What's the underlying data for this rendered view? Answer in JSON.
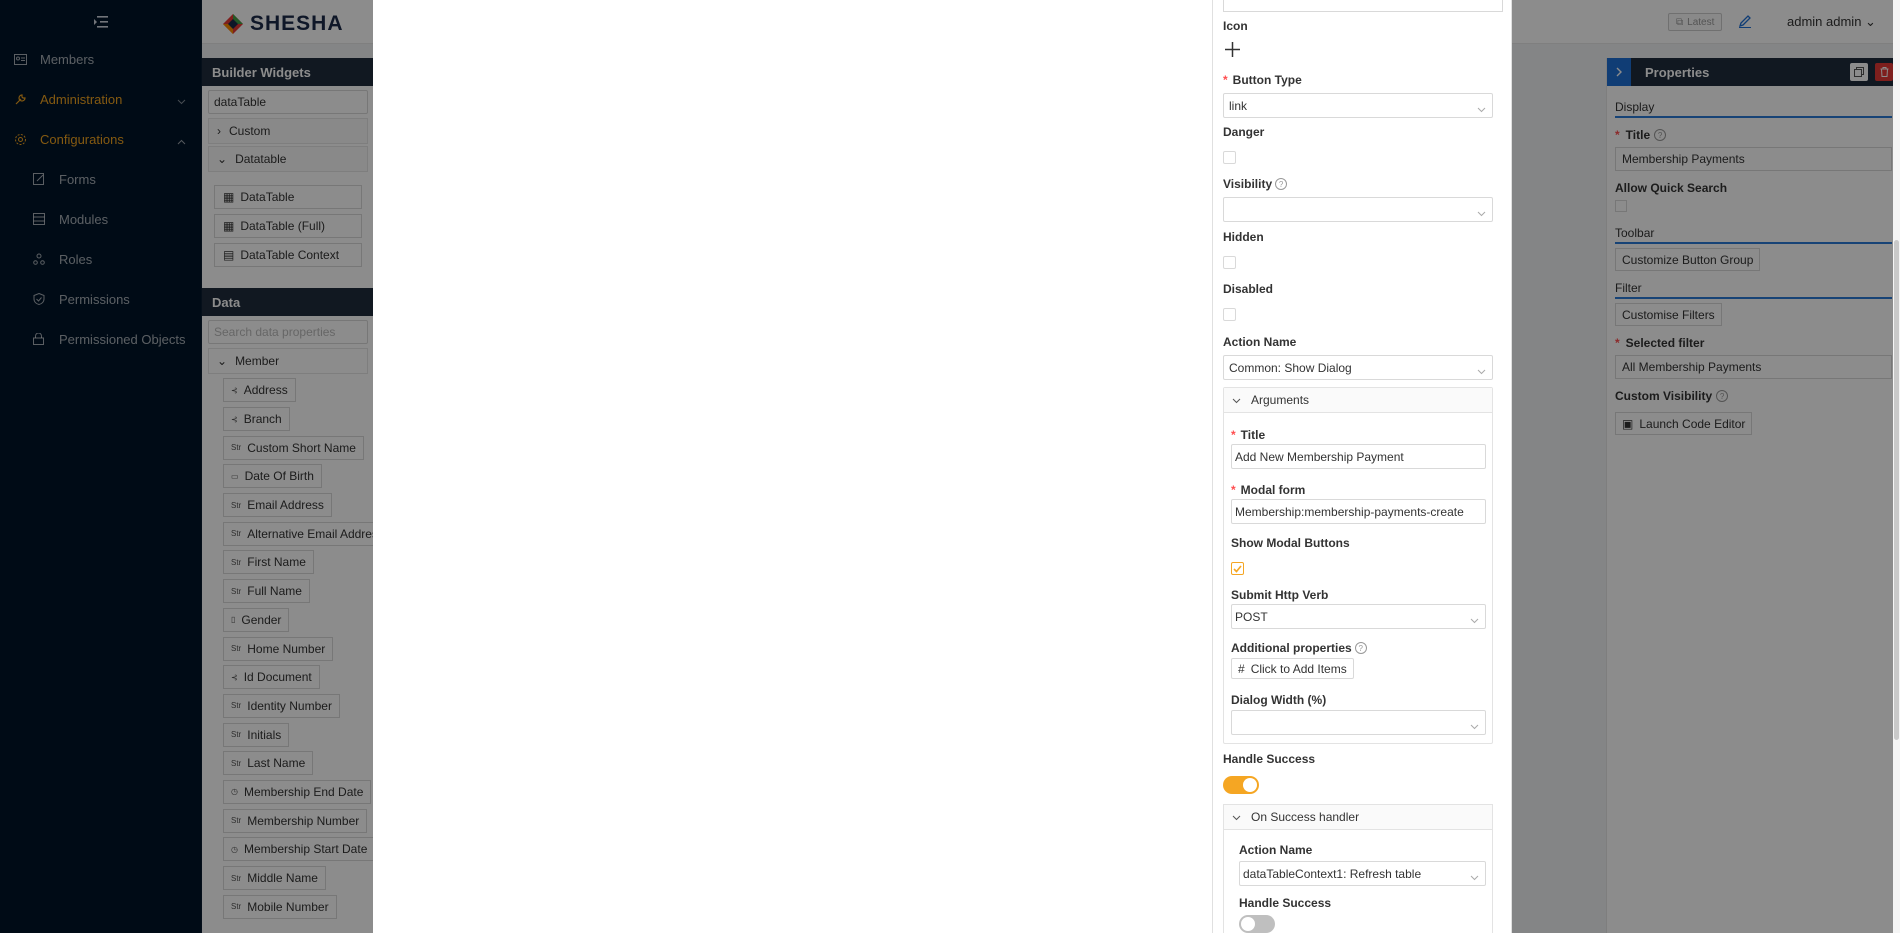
{
  "sidebar": {
    "items": [
      {
        "label": "Members",
        "icon": "profile-icon"
      },
      {
        "label": "Administration",
        "icon": "tool-icon"
      },
      {
        "label": "Configurations",
        "icon": "settings-icon"
      },
      {
        "label": "Forms",
        "icon": "form-edit-icon"
      },
      {
        "label": "Modules",
        "icon": "database-icon"
      },
      {
        "label": "Roles",
        "icon": "roles-icon"
      },
      {
        "label": "Permissions",
        "icon": "safety-icon"
      },
      {
        "label": "Permissioned Objects",
        "icon": "lock-icon"
      }
    ],
    "active_color": "#f0a31f"
  },
  "header": {
    "logo_text": "SHESHA",
    "version_badge": "Latest",
    "user": "admin admin"
  },
  "builder": {
    "title": "Builder Widgets",
    "search": "dataTable",
    "groups": [
      "Custom",
      "Datatable"
    ],
    "widgets": [
      "DataTable",
      "DataTable (Full)",
      "DataTable Context"
    ],
    "data_title": "Data",
    "data_search_placeholder": "Search data properties",
    "entity": "Member",
    "properties": [
      {
        "label": "Address",
        "icon": "entity-icon"
      },
      {
        "label": "Branch",
        "icon": "entity-icon"
      },
      {
        "label": "Custom Short Name",
        "icon": "string-icon"
      },
      {
        "label": "Date Of Birth",
        "icon": "calendar-icon"
      },
      {
        "label": "Email Address",
        "icon": "string-icon"
      },
      {
        "label": "Alternative Email Address",
        "icon": "string-icon"
      },
      {
        "label": "First Name",
        "icon": "string-icon"
      },
      {
        "label": "Full Name",
        "icon": "string-icon"
      },
      {
        "label": "Gender",
        "icon": "reflist-icon"
      },
      {
        "label": "Home Number",
        "icon": "string-icon"
      },
      {
        "label": "Id Document",
        "icon": "entity-icon"
      },
      {
        "label": "Identity Number",
        "icon": "string-icon"
      },
      {
        "label": "Initials",
        "icon": "string-icon"
      },
      {
        "label": "Last Name",
        "icon": "string-icon"
      },
      {
        "label": "Membership End Date",
        "icon": "clock-icon"
      },
      {
        "label": "Membership Number",
        "icon": "string-icon"
      },
      {
        "label": "Membership Start Date",
        "icon": "clock-icon"
      },
      {
        "label": "Middle Name",
        "icon": "string-icon"
      },
      {
        "label": "Mobile Number",
        "icon": "string-icon"
      }
    ]
  },
  "properties_panel": {
    "title": "Properties",
    "display_section": "Display",
    "title_label": "Title",
    "title_value": "Membership Payments",
    "quick_search_label": "Allow Quick Search",
    "toolbar_section": "Toolbar",
    "customize_button": "Customize Button Group",
    "filter_section": "Filter",
    "customise_filters": "Customise Filters",
    "selected_filter_label": "Selected filter",
    "selected_filter_value": "All Membership Payments",
    "custom_visibility_label": "Custom Visibility",
    "code_editor_button": "Launch Code Editor"
  },
  "drawer": {
    "icon_label": "Icon",
    "button_type_label": "Button Type",
    "button_type_value": "link",
    "danger_label": "Danger",
    "visibility_label": "Visibility",
    "visibility_value": "",
    "hidden_label": "Hidden",
    "disabled_label": "Disabled",
    "action_name_label": "Action Name",
    "action_name_value": "Common: Show Dialog",
    "arguments": {
      "header": "Arguments",
      "title_label": "Title",
      "title_value": "Add New Membership Payment",
      "modal_form_label": "Modal form",
      "modal_form_value": "Membership:membership-payments-create",
      "show_modal_buttons_label": "Show Modal Buttons",
      "show_modal_buttons_checked": true,
      "http_verb_label": "Submit Http Verb",
      "http_verb_value": "POST",
      "additional_props_label": "Additional properties",
      "add_items_button": "Click to Add Items",
      "dialog_width_label": "Dialog Width (%)",
      "dialog_width_value": ""
    },
    "handle_success_label": "Handle Success",
    "handle_success_on": true,
    "on_success": {
      "header": "On Success handler",
      "action_name_label": "Action Name",
      "action_name_value": "dataTableContext1: Refresh table",
      "handle_success_label": "Handle Success",
      "handle_success_on": false
    },
    "accent_color": "#f5a623"
  }
}
